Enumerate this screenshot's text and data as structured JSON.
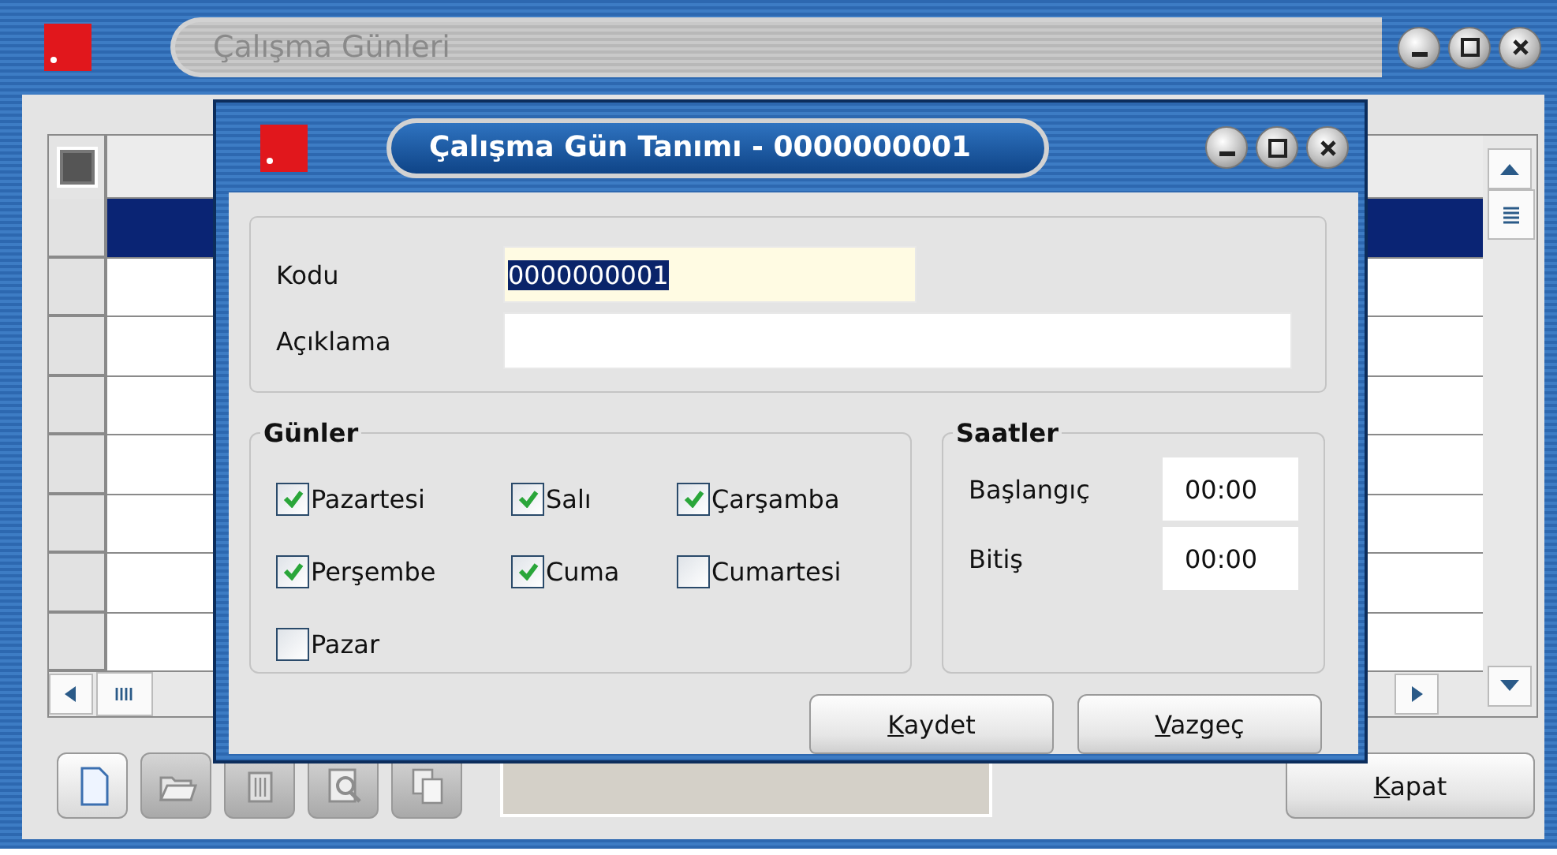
{
  "main_window": {
    "title": "Çalışma Günleri",
    "active": false
  },
  "grid": {
    "rows": [
      {
        "selected": true
      },
      {
        "selected": false
      },
      {
        "selected": false
      },
      {
        "selected": false
      },
      {
        "selected": false
      },
      {
        "selected": false
      },
      {
        "selected": false
      },
      {
        "selected": false
      }
    ]
  },
  "toolbar": [
    {
      "kind": "new",
      "disabled": false
    },
    {
      "kind": "open",
      "disabled": true
    },
    {
      "kind": "delete",
      "disabled": true
    },
    {
      "kind": "preview",
      "disabled": true
    },
    {
      "kind": "copy",
      "disabled": true
    }
  ],
  "close_button": "Kapat",
  "dialog": {
    "title": "Çalışma Gün Tanımı - 0000000001",
    "active": true,
    "fields": [
      {
        "label": "Kodu",
        "value": "0000000001",
        "value_selected": true,
        "focused": true
      },
      {
        "label": "Açıklama",
        "focused": false
      }
    ],
    "days": {
      "title": "Günler",
      "items": [
        {
          "label": "Pazartesi",
          "checked": true
        },
        {
          "label": "Salı",
          "checked": true
        },
        {
          "label": "Çarşamba",
          "checked": true
        },
        {
          "label": "Perşembe",
          "checked": true
        },
        {
          "label": "Cuma",
          "checked": true
        },
        {
          "label": "Cumartesi",
          "checked": false
        },
        {
          "label": "Pazar",
          "checked": false
        }
      ]
    },
    "hours": {
      "title": "Saatler",
      "items": [
        {
          "label": "Başlangıç",
          "value": "00:00"
        },
        {
          "label": "Bitiş",
          "value": "00:00"
        }
      ]
    },
    "buttons": [
      "Kaydet",
      "Vazgeç"
    ]
  }
}
